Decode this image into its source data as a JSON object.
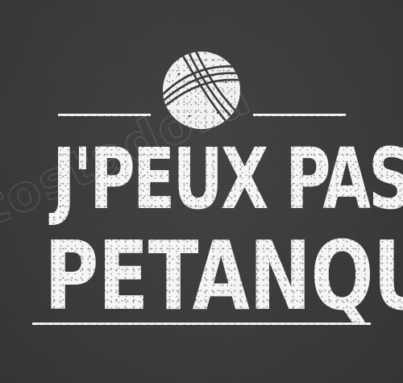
{
  "design": {
    "line1": "J'PEUX PAS J'AI",
    "line2": "PETANQUE",
    "watermark": "tostadora",
    "icon": "petanque-ball-icon"
  },
  "colors": {
    "background": "#3b3b3c",
    "ink": "#f5f5f5"
  }
}
